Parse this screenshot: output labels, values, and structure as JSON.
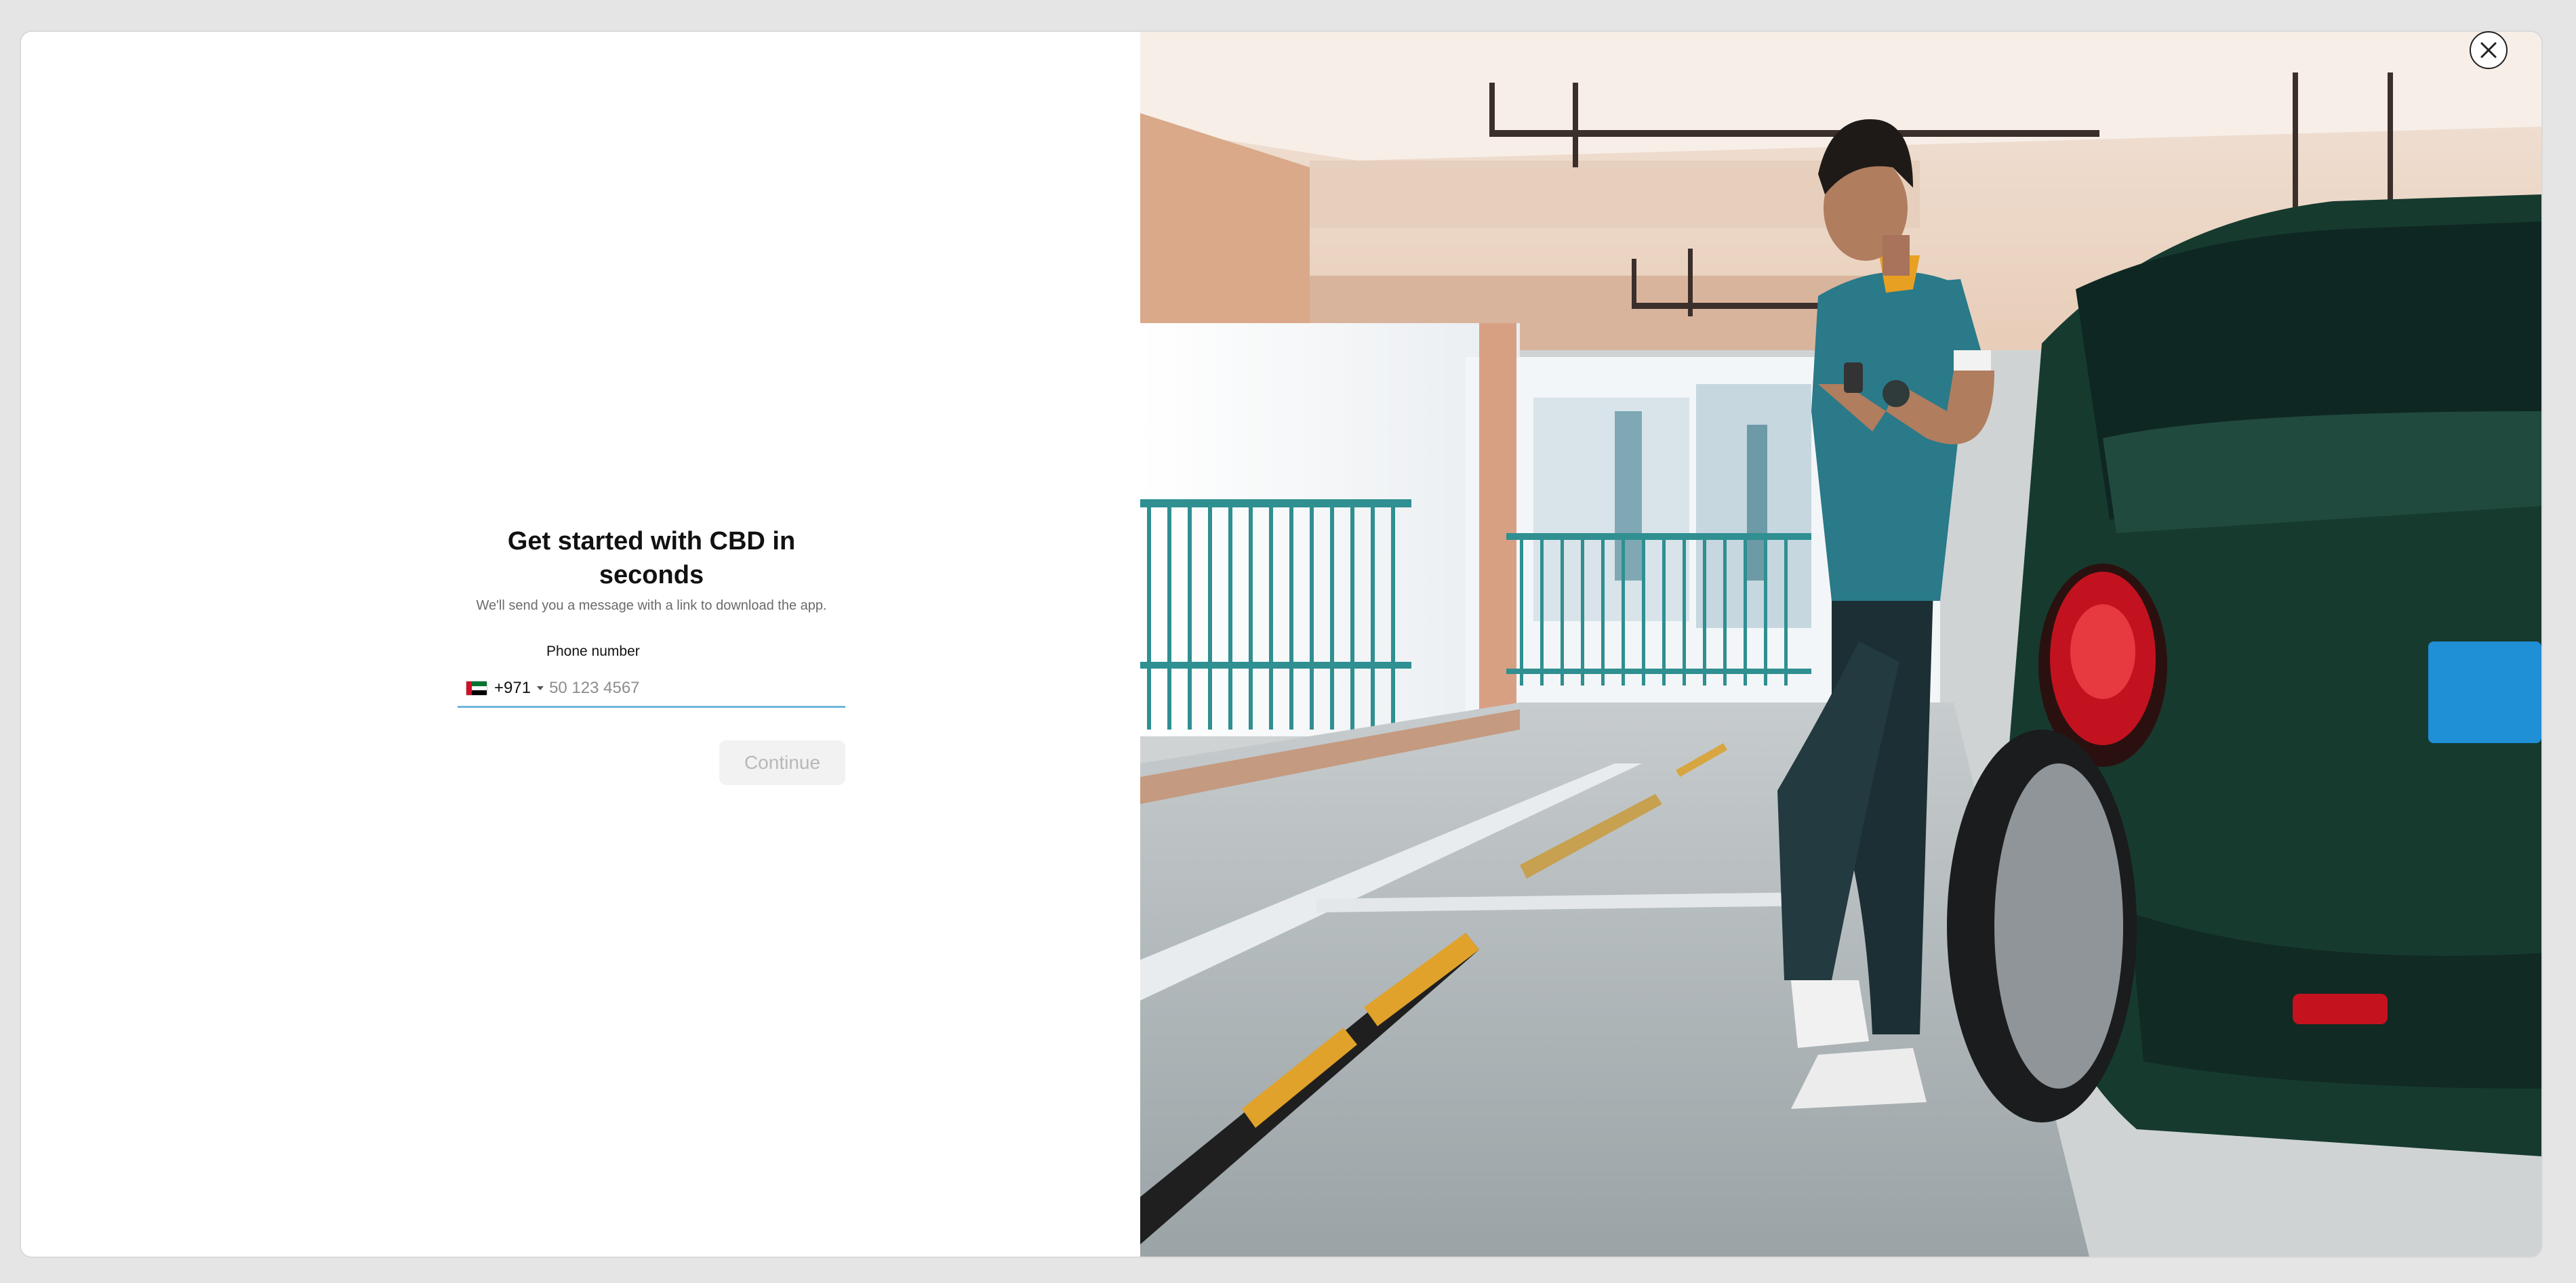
{
  "signup": {
    "title": "Get started with CBD in seconds",
    "subtitle": "We'll send you a message with a link to download the app.",
    "phone_label": "Phone number",
    "country": {
      "dial_code": "+971",
      "flag_icon": "uae-flag-icon"
    },
    "phone_placeholder": "50 123 4567",
    "phone_value": "",
    "continue_label": "Continue"
  },
  "close_icon": "close-icon",
  "colors": {
    "input_underline": "#6fb7d9",
    "button_disabled_bg": "#f2f2f2",
    "button_disabled_text": "#b8b8b8"
  }
}
